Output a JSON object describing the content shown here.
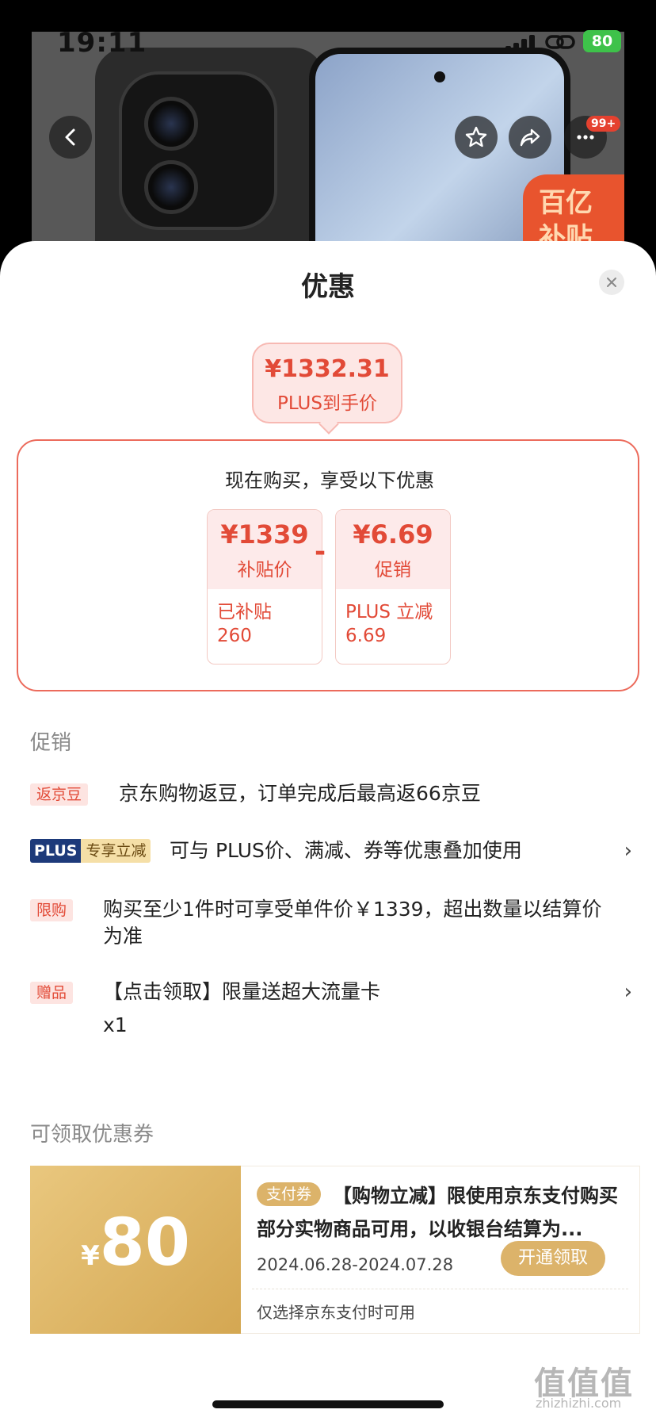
{
  "status": {
    "time": "19:11",
    "battery": "80"
  },
  "hero": {
    "sticker": "百亿\n补贴",
    "badge": "99+"
  },
  "sheet": {
    "title": "优惠"
  },
  "final_price": {
    "value": "¥1332.31",
    "label": "PLUS到手价"
  },
  "calc": {
    "heading": "现在购买，享受以下优惠",
    "minus": "-",
    "cards": [
      {
        "amount": "¥1339",
        "name": "补贴价",
        "detail_line1": "已补贴",
        "detail_line2": "260"
      },
      {
        "amount": "¥6.69",
        "name": "促销",
        "detail_line1": "PLUS 立减",
        "detail_line2": "6.69"
      }
    ]
  },
  "promotions": {
    "label": "促销",
    "items": [
      {
        "tag": "返京豆",
        "text": "京东购物返豆，订单完成后最高返66京豆"
      },
      {
        "tag_a": "PLUS",
        "tag_b": "专享立减",
        "text": "可与 PLUS价、满减、券等优惠叠加使用",
        "chevron": "›"
      },
      {
        "tag": "限购",
        "text": "购买至少1件时可享受单件价￥1339，超出数量以结算价为准"
      },
      {
        "tag": "赠品",
        "text": "【点击领取】限量送超大流量卡",
        "sub": "x1",
        "chevron": "›"
      }
    ]
  },
  "coupons": {
    "label": "可领取优惠券",
    "items": [
      {
        "yen": "¥",
        "amount": "80",
        "tag": "支付券",
        "title": "【购物立减】限使用京东支付购买部分实物商品可用，以收银台结算为...",
        "date": "2024.06.28-2024.07.28",
        "button": "开通领取",
        "note": "仅选择京东支付时可用"
      }
    ]
  },
  "watermark": {
    "main": "值值值",
    "sub": "zhizhizhi.com"
  }
}
